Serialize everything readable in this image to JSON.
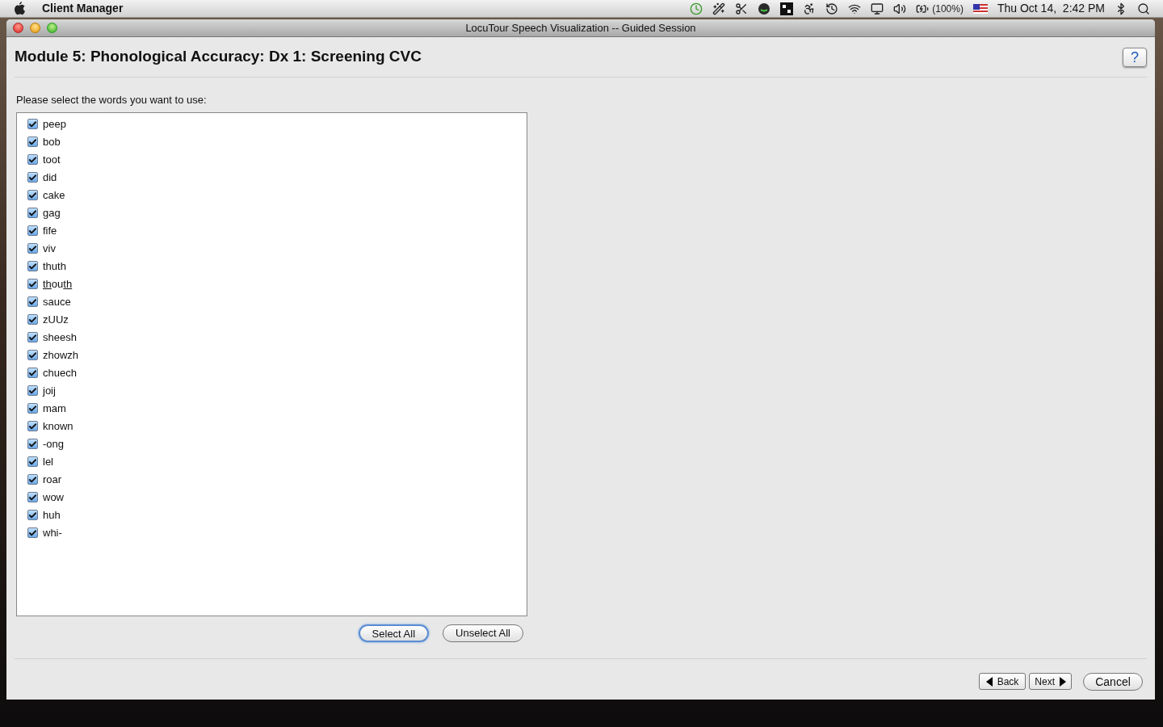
{
  "menu_bar": {
    "app_name": "Client Manager",
    "battery": "(100%)",
    "clock": "Thu Oct 14,  2:42 PM"
  },
  "window": {
    "title": "LocuTour Speech Visualization -- Guided Session"
  },
  "heading": "Module 5: Phonological Accuracy: Dx 1: Screening CVC",
  "help_button": "?",
  "prompt": "Please select the words you want to use:",
  "words": [
    {
      "segments": [
        {
          "text": "peep",
          "underlined": false
        }
      ],
      "checked": true
    },
    {
      "segments": [
        {
          "text": "bob",
          "underlined": false
        }
      ],
      "checked": true
    },
    {
      "segments": [
        {
          "text": "toot",
          "underlined": false
        }
      ],
      "checked": true
    },
    {
      "segments": [
        {
          "text": "did",
          "underlined": false
        }
      ],
      "checked": true
    },
    {
      "segments": [
        {
          "text": "cake",
          "underlined": false
        }
      ],
      "checked": true
    },
    {
      "segments": [
        {
          "text": "gag",
          "underlined": false
        }
      ],
      "checked": true
    },
    {
      "segments": [
        {
          "text": "fife",
          "underlined": false
        }
      ],
      "checked": true
    },
    {
      "segments": [
        {
          "text": "viv",
          "underlined": false
        }
      ],
      "checked": true
    },
    {
      "segments": [
        {
          "text": "thuth",
          "underlined": false
        }
      ],
      "checked": true
    },
    {
      "segments": [
        {
          "text": "th",
          "underlined": true
        },
        {
          "text": "ou",
          "underlined": false
        },
        {
          "text": "th",
          "underlined": true
        }
      ],
      "checked": true
    },
    {
      "segments": [
        {
          "text": "sauce",
          "underlined": false
        }
      ],
      "checked": true
    },
    {
      "segments": [
        {
          "text": "zUUz",
          "underlined": false
        }
      ],
      "checked": true
    },
    {
      "segments": [
        {
          "text": "sheesh",
          "underlined": false
        }
      ],
      "checked": true
    },
    {
      "segments": [
        {
          "text": "zhowzh",
          "underlined": false
        }
      ],
      "checked": true
    },
    {
      "segments": [
        {
          "text": "chuech",
          "underlined": false
        }
      ],
      "checked": true
    },
    {
      "segments": [
        {
          "text": "joij",
          "underlined": false
        }
      ],
      "checked": true
    },
    {
      "segments": [
        {
          "text": "mam",
          "underlined": false
        }
      ],
      "checked": true
    },
    {
      "segments": [
        {
          "text": "known",
          "underlined": false
        }
      ],
      "checked": true
    },
    {
      "segments": [
        {
          "text": "-ong",
          "underlined": false
        }
      ],
      "checked": true
    },
    {
      "segments": [
        {
          "text": "lel",
          "underlined": false
        }
      ],
      "checked": true
    },
    {
      "segments": [
        {
          "text": "roar",
          "underlined": false
        }
      ],
      "checked": true
    },
    {
      "segments": [
        {
          "text": "wow",
          "underlined": false
        }
      ],
      "checked": true
    },
    {
      "segments": [
        {
          "text": "huh",
          "underlined": false
        }
      ],
      "checked": true
    },
    {
      "segments": [
        {
          "text": "whi-",
          "underlined": false
        }
      ],
      "checked": true
    }
  ],
  "list_buttons": [
    {
      "label": "Select All",
      "selected": true
    },
    {
      "label": "Unselect All",
      "selected": false
    }
  ],
  "nav_buttons": {
    "back": "Back",
    "next": "Next",
    "cancel": "Cancel"
  }
}
